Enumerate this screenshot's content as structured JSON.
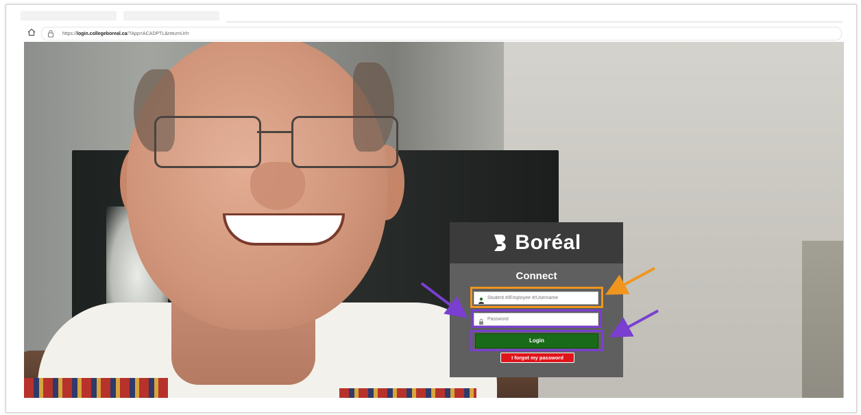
{
  "browser": {
    "url_prefix": "https://",
    "url_host": "login.collegeboreal.ca",
    "url_path": "/?App=ACADPTL&returnUrl="
  },
  "login": {
    "brand": "Boréal",
    "title": "Connect",
    "username_placeholder": "Student #/Employee #/Username",
    "password_placeholder": "Password",
    "login_label": "Login",
    "forgot_label": "I forgot my password"
  },
  "annotations": {
    "username_highlight_color": "#f0961e",
    "password_highlight_color": "#7a3fd0",
    "login_highlight_color": "#7a3fd0"
  },
  "icons": {
    "home": "home-icon",
    "lock": "lock-icon",
    "brand": "boreal-logo-icon",
    "user": "user-icon",
    "password": "lock-icon"
  }
}
